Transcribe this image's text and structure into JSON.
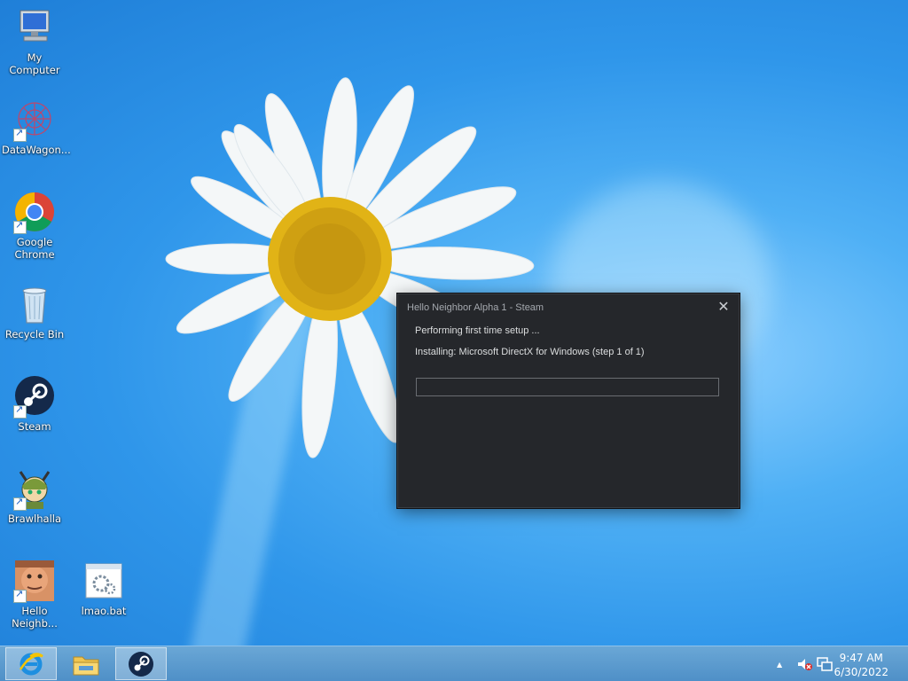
{
  "desktop": {
    "icons": [
      {
        "label": "My Computer",
        "icon": "computer-icon"
      },
      {
        "label": "DataWagon...",
        "icon": "datawagon-icon"
      },
      {
        "label": "Google Chrome",
        "icon": "chrome-icon"
      },
      {
        "label": "Recycle Bin",
        "icon": "recycle-bin-icon"
      },
      {
        "label": "Steam",
        "icon": "steam-icon"
      },
      {
        "label": "Brawlhalla",
        "icon": "brawlhalla-icon"
      },
      {
        "label": "Hello Neighb...",
        "icon": "hello-neighbor-icon"
      },
      {
        "label": "lmao.bat",
        "icon": "batch-file-icon"
      }
    ]
  },
  "dialog": {
    "title": "Hello Neighbor Alpha 1 - Steam",
    "close": "✕",
    "status_line": "Performing first time setup ...",
    "detail_line": "Installing: Microsoft DirectX for Windows (step 1 of 1)",
    "progress": 0
  },
  "taskbar": {
    "pinned": [
      {
        "name": "Internet Explorer",
        "icon": "internet-explorer-icon",
        "active": true
      },
      {
        "name": "File Explorer",
        "icon": "folder-icon",
        "active": false
      },
      {
        "name": "Steam",
        "icon": "steam-icon",
        "active": true
      }
    ],
    "tray": {
      "show_hidden": "▲",
      "time": "9:47 AM",
      "date": "6/30/2022"
    }
  },
  "colors": {
    "dialog_bg": "#25272b",
    "taskbar": "#5a9acd",
    "desktop_blue": "#2f96ea"
  }
}
